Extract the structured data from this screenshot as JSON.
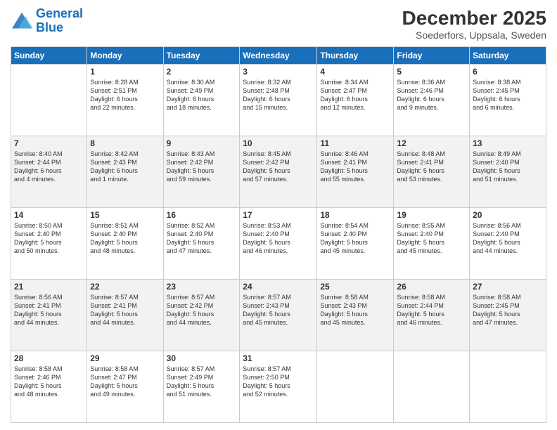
{
  "logo": {
    "line1": "General",
    "line2": "Blue"
  },
  "title": "December 2025",
  "subtitle": "Soederfors, Uppsala, Sweden",
  "days_header": [
    "Sunday",
    "Monday",
    "Tuesday",
    "Wednesday",
    "Thursday",
    "Friday",
    "Saturday"
  ],
  "weeks": [
    [
      {
        "num": "",
        "info": ""
      },
      {
        "num": "1",
        "info": "Sunrise: 8:28 AM\nSunset: 2:51 PM\nDaylight: 6 hours\nand 22 minutes."
      },
      {
        "num": "2",
        "info": "Sunrise: 8:30 AM\nSunset: 2:49 PM\nDaylight: 6 hours\nand 18 minutes."
      },
      {
        "num": "3",
        "info": "Sunrise: 8:32 AM\nSunset: 2:48 PM\nDaylight: 6 hours\nand 15 minutes."
      },
      {
        "num": "4",
        "info": "Sunrise: 8:34 AM\nSunset: 2:47 PM\nDaylight: 6 hours\nand 12 minutes."
      },
      {
        "num": "5",
        "info": "Sunrise: 8:36 AM\nSunset: 2:46 PM\nDaylight: 6 hours\nand 9 minutes."
      },
      {
        "num": "6",
        "info": "Sunrise: 8:38 AM\nSunset: 2:45 PM\nDaylight: 6 hours\nand 6 minutes."
      }
    ],
    [
      {
        "num": "7",
        "info": "Sunrise: 8:40 AM\nSunset: 2:44 PM\nDaylight: 6 hours\nand 4 minutes."
      },
      {
        "num": "8",
        "info": "Sunrise: 8:42 AM\nSunset: 2:43 PM\nDaylight: 6 hours\nand 1 minute."
      },
      {
        "num": "9",
        "info": "Sunrise: 8:43 AM\nSunset: 2:42 PM\nDaylight: 5 hours\nand 59 minutes."
      },
      {
        "num": "10",
        "info": "Sunrise: 8:45 AM\nSunset: 2:42 PM\nDaylight: 5 hours\nand 57 minutes."
      },
      {
        "num": "11",
        "info": "Sunrise: 8:46 AM\nSunset: 2:41 PM\nDaylight: 5 hours\nand 55 minutes."
      },
      {
        "num": "12",
        "info": "Sunrise: 8:48 AM\nSunset: 2:41 PM\nDaylight: 5 hours\nand 53 minutes."
      },
      {
        "num": "13",
        "info": "Sunrise: 8:49 AM\nSunset: 2:40 PM\nDaylight: 5 hours\nand 51 minutes."
      }
    ],
    [
      {
        "num": "14",
        "info": "Sunrise: 8:50 AM\nSunset: 2:40 PM\nDaylight: 5 hours\nand 50 minutes."
      },
      {
        "num": "15",
        "info": "Sunrise: 8:51 AM\nSunset: 2:40 PM\nDaylight: 5 hours\nand 48 minutes."
      },
      {
        "num": "16",
        "info": "Sunrise: 8:52 AM\nSunset: 2:40 PM\nDaylight: 5 hours\nand 47 minutes."
      },
      {
        "num": "17",
        "info": "Sunrise: 8:53 AM\nSunset: 2:40 PM\nDaylight: 5 hours\nand 46 minutes."
      },
      {
        "num": "18",
        "info": "Sunrise: 8:54 AM\nSunset: 2:40 PM\nDaylight: 5 hours\nand 45 minutes."
      },
      {
        "num": "19",
        "info": "Sunrise: 8:55 AM\nSunset: 2:40 PM\nDaylight: 5 hours\nand 45 minutes."
      },
      {
        "num": "20",
        "info": "Sunrise: 8:56 AM\nSunset: 2:40 PM\nDaylight: 5 hours\nand 44 minutes."
      }
    ],
    [
      {
        "num": "21",
        "info": "Sunrise: 8:56 AM\nSunset: 2:41 PM\nDaylight: 5 hours\nand 44 minutes."
      },
      {
        "num": "22",
        "info": "Sunrise: 8:57 AM\nSunset: 2:41 PM\nDaylight: 5 hours\nand 44 minutes."
      },
      {
        "num": "23",
        "info": "Sunrise: 8:57 AM\nSunset: 2:42 PM\nDaylight: 5 hours\nand 44 minutes."
      },
      {
        "num": "24",
        "info": "Sunrise: 8:57 AM\nSunset: 2:43 PM\nDaylight: 5 hours\nand 45 minutes."
      },
      {
        "num": "25",
        "info": "Sunrise: 8:58 AM\nSunset: 2:43 PM\nDaylight: 5 hours\nand 45 minutes."
      },
      {
        "num": "26",
        "info": "Sunrise: 8:58 AM\nSunset: 2:44 PM\nDaylight: 5 hours\nand 46 minutes."
      },
      {
        "num": "27",
        "info": "Sunrise: 8:58 AM\nSunset: 2:45 PM\nDaylight: 5 hours\nand 47 minutes."
      }
    ],
    [
      {
        "num": "28",
        "info": "Sunrise: 8:58 AM\nSunset: 2:46 PM\nDaylight: 5 hours\nand 48 minutes."
      },
      {
        "num": "29",
        "info": "Sunrise: 8:58 AM\nSunset: 2:47 PM\nDaylight: 5 hours\nand 49 minutes."
      },
      {
        "num": "30",
        "info": "Sunrise: 8:57 AM\nSunset: 2:49 PM\nDaylight: 5 hours\nand 51 minutes."
      },
      {
        "num": "31",
        "info": "Sunrise: 8:57 AM\nSunset: 2:50 PM\nDaylight: 5 hours\nand 52 minutes."
      },
      {
        "num": "",
        "info": ""
      },
      {
        "num": "",
        "info": ""
      },
      {
        "num": "",
        "info": ""
      }
    ]
  ]
}
